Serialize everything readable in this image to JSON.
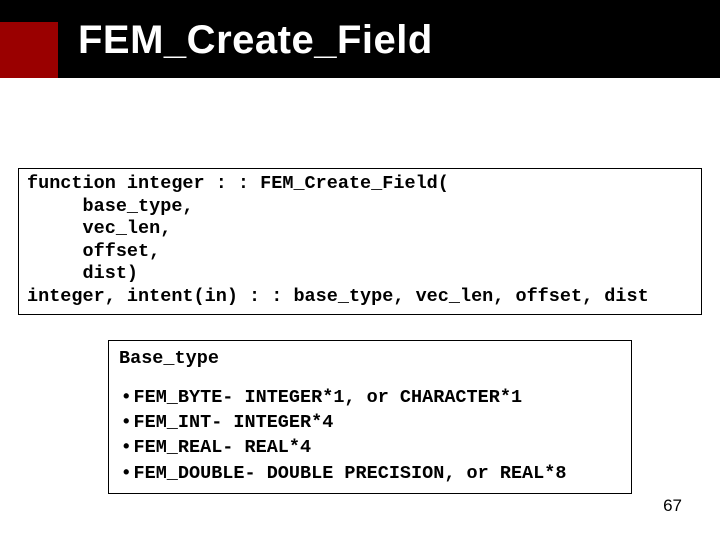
{
  "title": "FEM_Create_Field",
  "code_box1": "function integer : : FEM_Create_Field(\n     base_type,\n     vec_len,\n     offset,\n     dist)\ninteger, intent(in) : : base_type, vec_len, offset, dist",
  "box2": {
    "heading": "Base_type",
    "items": [
      "FEM_BYTE- INTEGER*1, or CHARACTER*1",
      "FEM_INT- INTEGER*4",
      "FEM_REAL- REAL*4",
      "FEM_DOUBLE- DOUBLE PRECISION, or REAL*8"
    ]
  },
  "page_number": "67"
}
